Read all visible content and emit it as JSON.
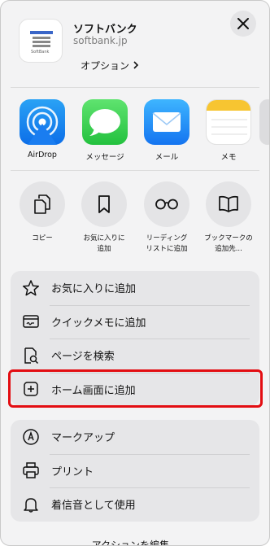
{
  "header": {
    "site_title": "ソフトバンク",
    "site_url": "softbank.jp",
    "options_label": "オプション ",
    "icon_small_text": "SoftBank"
  },
  "apps": [
    {
      "label": "AirDrop",
      "icon": "airdrop-icon"
    },
    {
      "label": "メッセージ",
      "icon": "messages-icon"
    },
    {
      "label": "メール",
      "icon": "mail-icon"
    },
    {
      "label": "メモ",
      "icon": "notes-icon"
    }
  ],
  "actions": [
    {
      "label": "コピー",
      "icon": "copy-icon"
    },
    {
      "label": "お気に入りに\n追加",
      "icon": "bookmark-icon"
    },
    {
      "label": "リーディング\nリストに追加",
      "icon": "reading-list-icon"
    },
    {
      "label": "ブックマークの\n追加先...",
      "icon": "book-icon"
    }
  ],
  "group1": [
    {
      "label": "お気に入りに追加",
      "icon": "star-icon"
    },
    {
      "label": "クイックメモに追加",
      "icon": "quick-note-icon"
    },
    {
      "label": "ページを検索",
      "icon": "find-page-icon"
    },
    {
      "label": "ホーム画面に追加",
      "icon": "add-square-icon"
    }
  ],
  "group2": [
    {
      "label": "マークアップ",
      "icon": "markup-icon"
    },
    {
      "label": "プリント",
      "icon": "printer-icon"
    },
    {
      "label": "着信音として使用",
      "icon": "ringtone-icon"
    }
  ],
  "footer": {
    "edit_actions": "アクションを編集..."
  },
  "colors": {
    "highlight": "#e30d12"
  }
}
